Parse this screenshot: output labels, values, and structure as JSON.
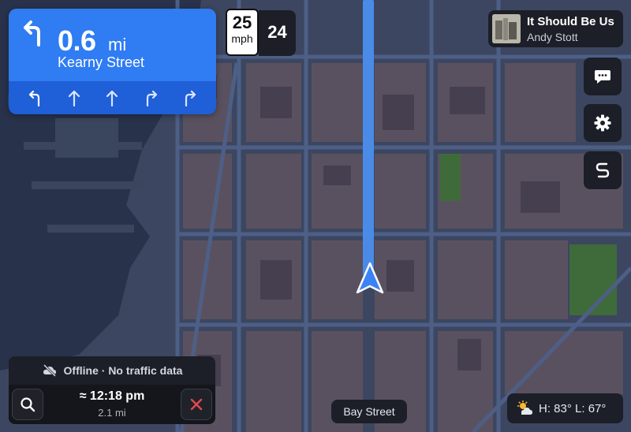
{
  "navigation": {
    "distance_value": "0.6",
    "distance_unit": "mi",
    "street": "Kearny Street",
    "maneuver_icon": "turn-left-arrow-icon",
    "lanes": [
      "turn-left",
      "straight",
      "straight",
      "turn-right",
      "turn-right"
    ]
  },
  "speed": {
    "limit": "25",
    "unit": "mph",
    "current": "24"
  },
  "now_playing": {
    "title": "It Should Be Us",
    "artist": "Andy Stott"
  },
  "side_buttons": [
    "message-icon",
    "gear-icon",
    "route-icon"
  ],
  "trip": {
    "offline_text": "Offline · No traffic data",
    "eta": "≈ 12:18 pm",
    "distance": "2.1 mi"
  },
  "current_street": "Bay Street",
  "weather": {
    "icon": "partly-cloudy-icon",
    "text": "H: 83°  L: 67°"
  },
  "colors": {
    "accent": "#2f7cf3",
    "route": "#4a8be8",
    "close": "#e5484d",
    "park": "#3f6a3a"
  }
}
